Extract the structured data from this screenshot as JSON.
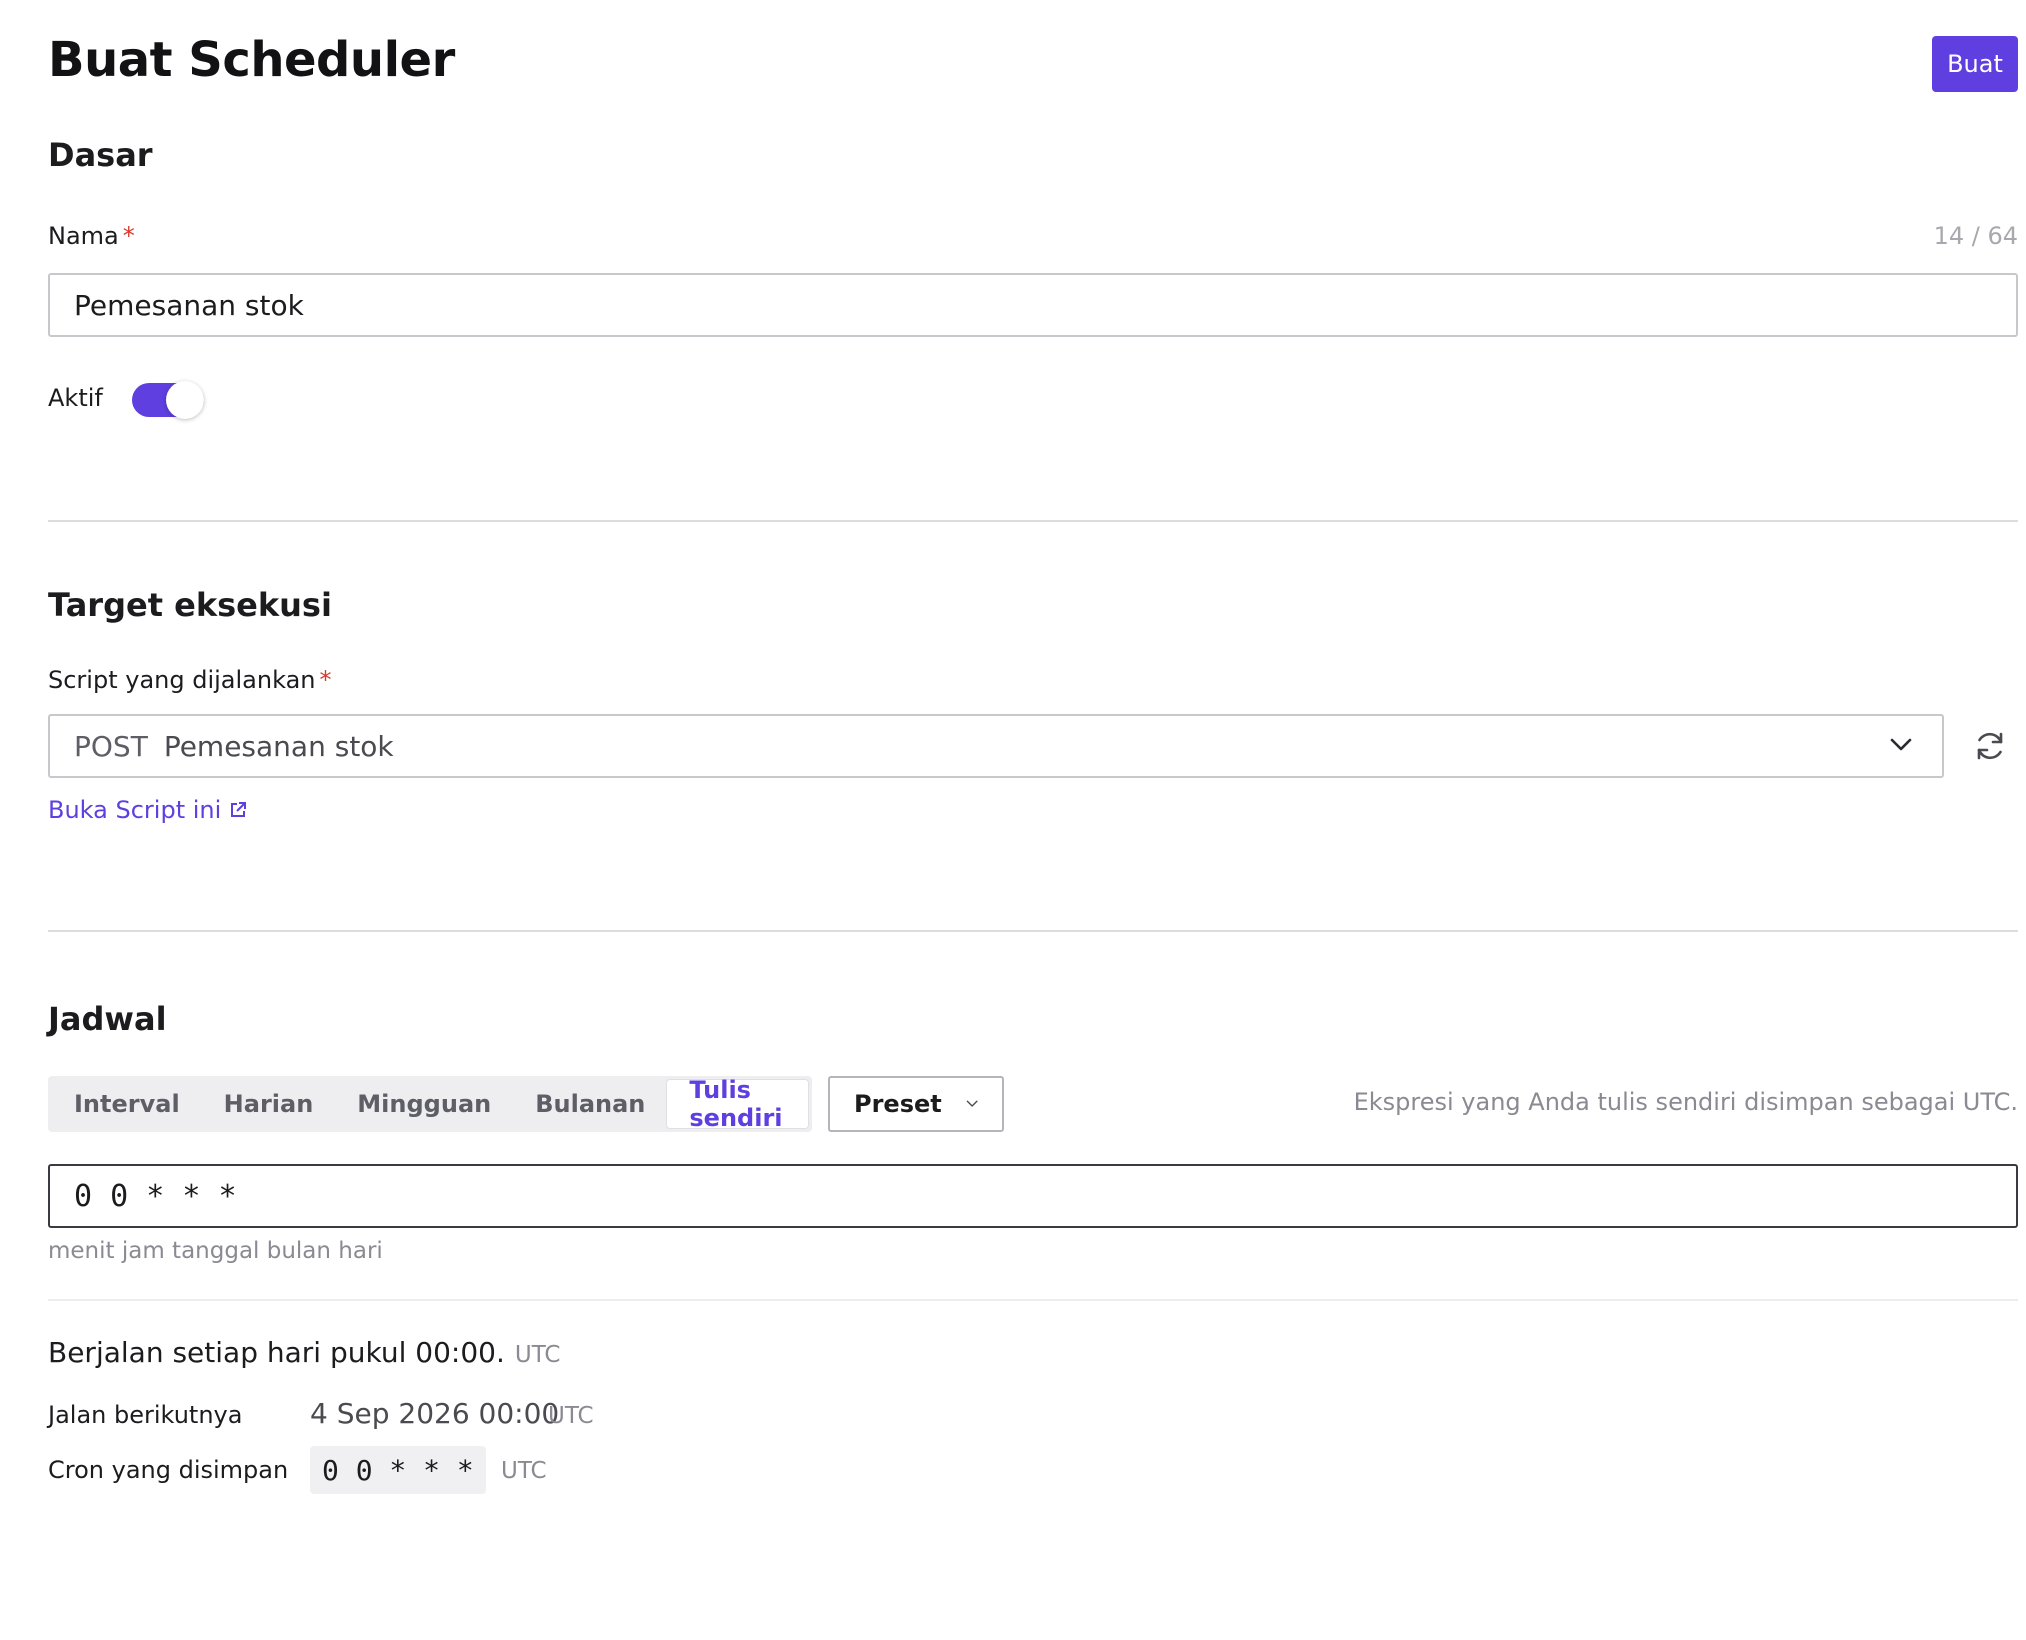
{
  "header": {
    "title": "Buat Scheduler",
    "create_label": "Buat"
  },
  "basic": {
    "section_title": "Dasar",
    "name_label": "Nama",
    "required_mark": "*",
    "counter": "14 / 64",
    "name_value": "Pemesanan stok",
    "active_label": "Aktif",
    "active_on": true
  },
  "target": {
    "section_title": "Target eksekusi",
    "script_label": "Script yang dijalankan",
    "required_mark": "*",
    "method": "POST",
    "script_value": "Pemesanan stok",
    "open_link": "Buka Script ini"
  },
  "schedule": {
    "section_title": "Jadwal",
    "tabs": [
      "Interval",
      "Harian",
      "Mingguan",
      "Bulanan",
      "Tulis sendiri"
    ],
    "active_tab": "Tulis sendiri",
    "preset_label": "Preset",
    "utc_hint": "Ekspresi yang Anda tulis sendiri disimpan sebagai UTC.",
    "cron_value": "0 0 * * *",
    "cron_fields_hint": "menit jam tanggal bulan hari",
    "summary_text": "Berjalan setiap hari pukul 00:00.",
    "summary_tz": "UTC",
    "next_run_label": "Jalan berikutnya",
    "next_run_value": "4 Sep 2026 00:00",
    "next_run_tz": "UTC",
    "saved_cron_label": "Cron yang disimpan",
    "saved_cron_value": "0 0 * * *",
    "saved_cron_tz": "UTC"
  },
  "colors": {
    "accent": "#5f3fe0",
    "required": "#d9372b"
  }
}
